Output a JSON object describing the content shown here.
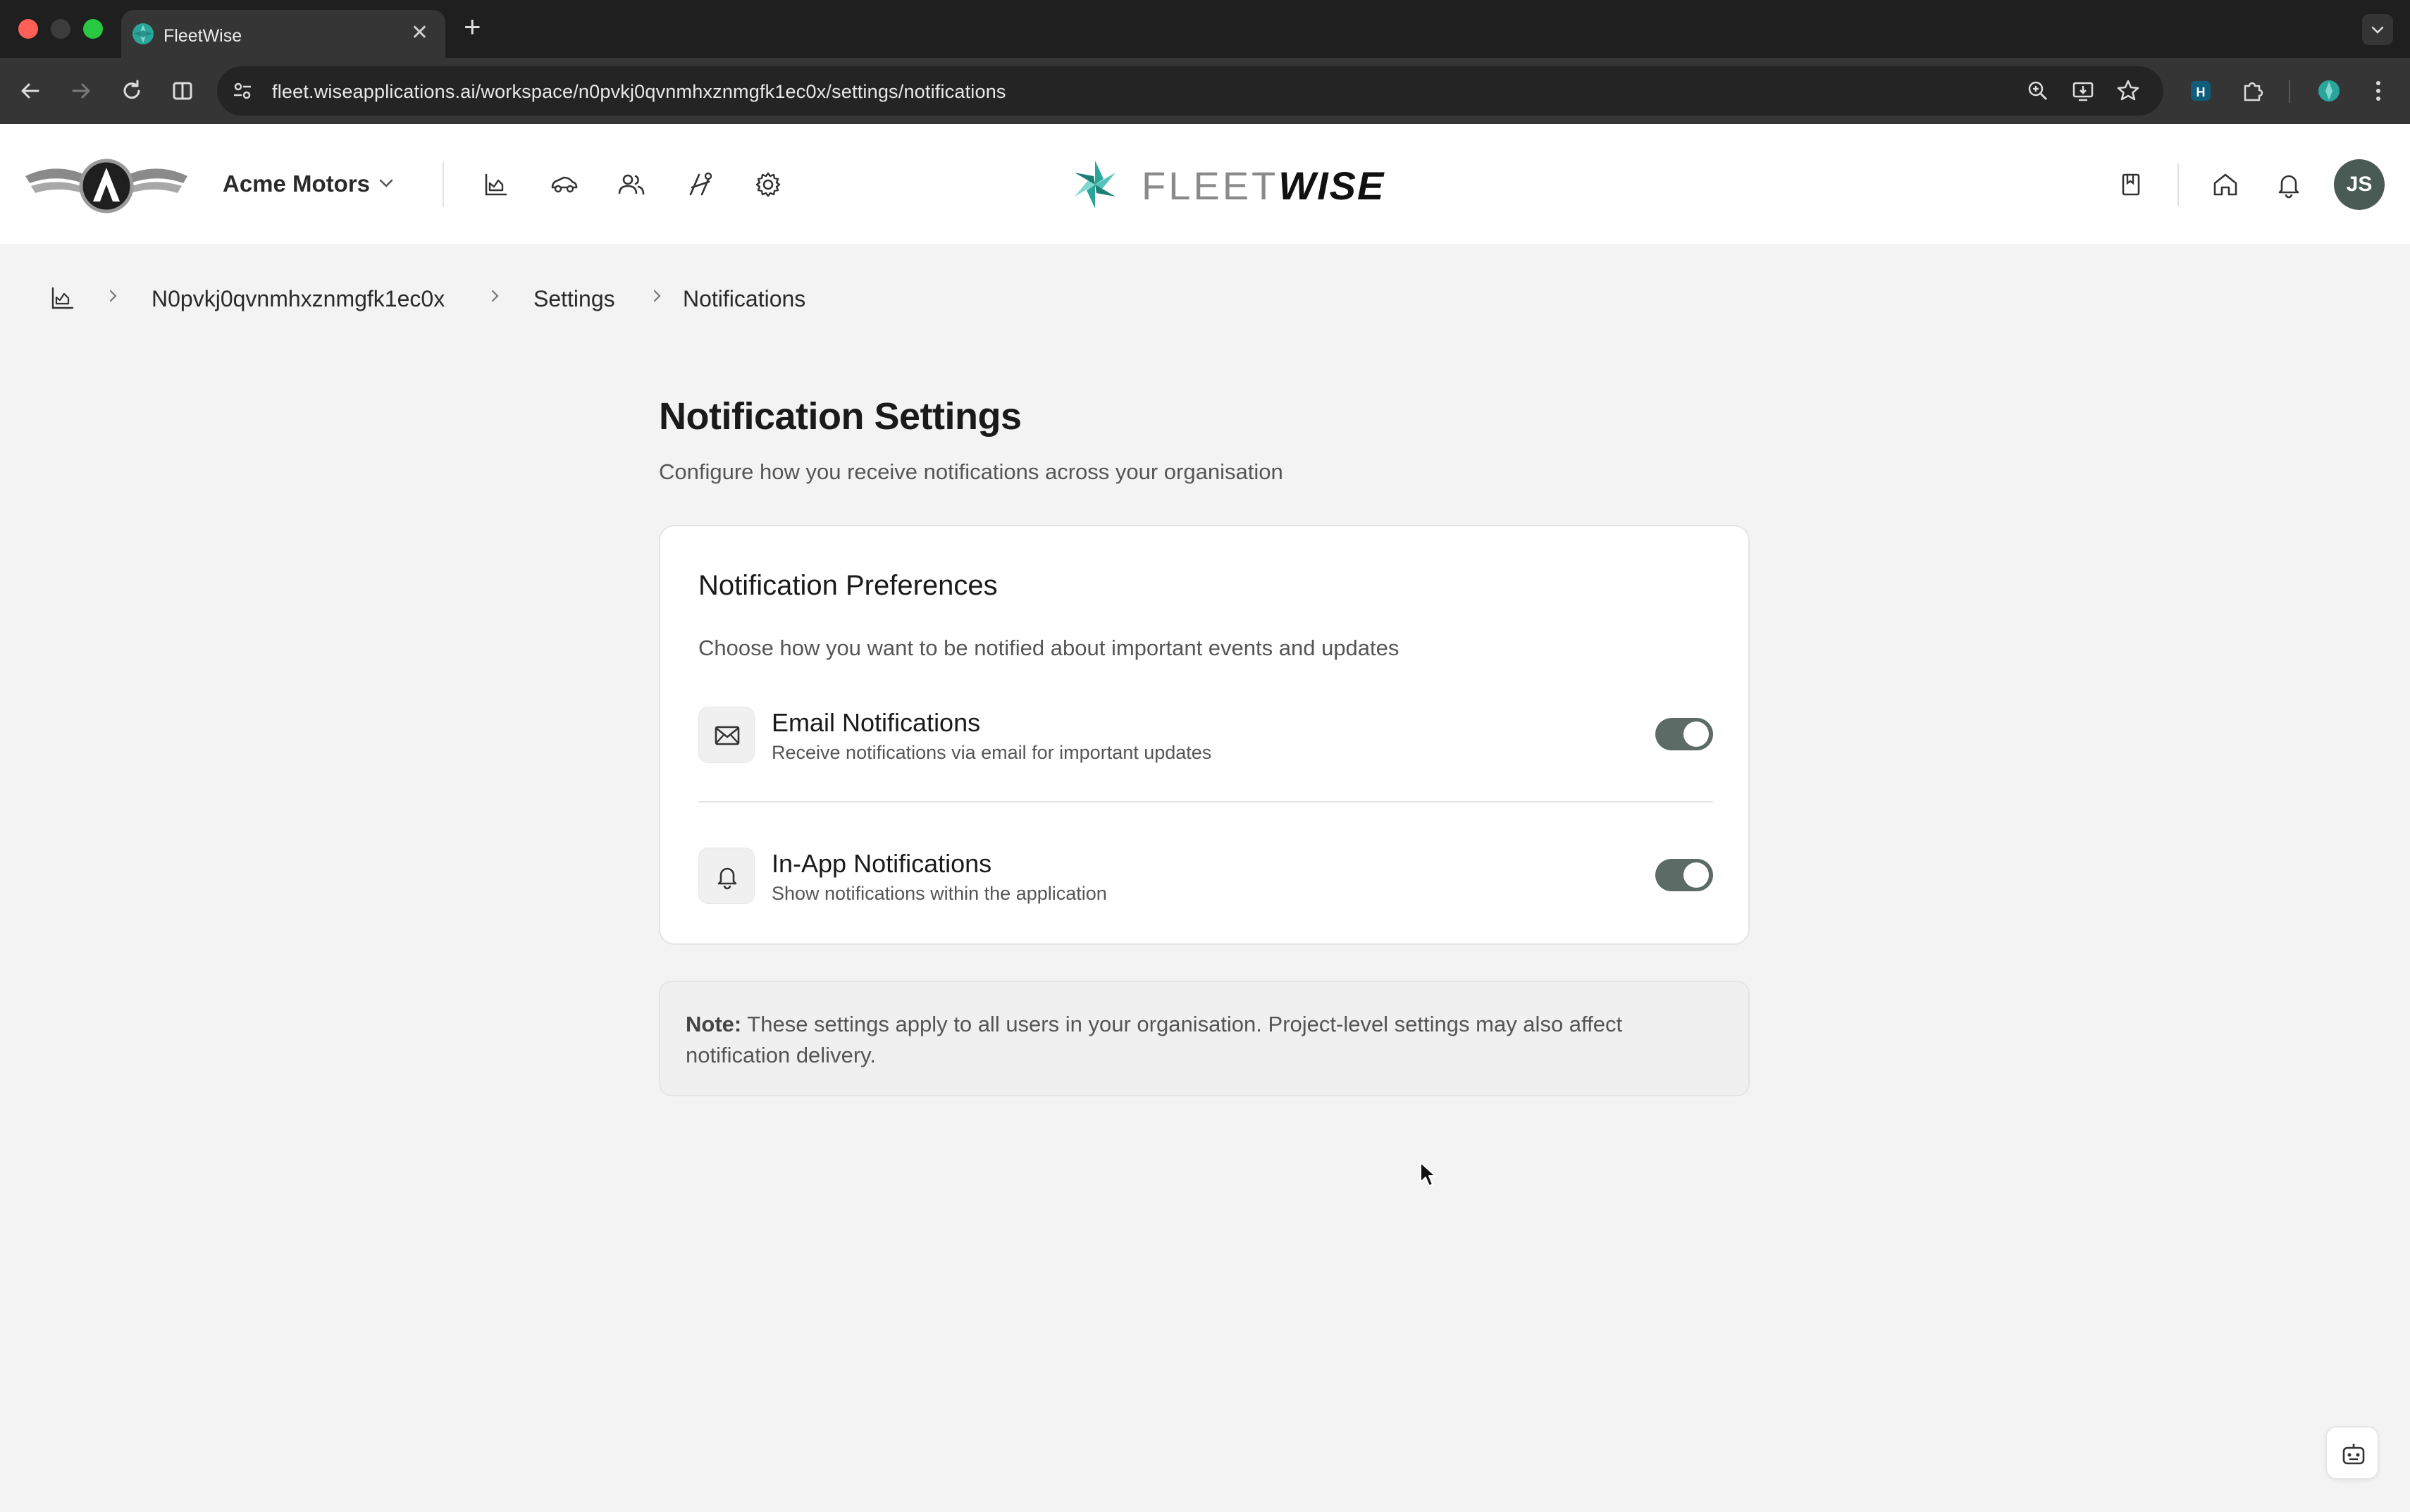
{
  "browser": {
    "tab_title": "FleetWise",
    "new_tab_symbol": "+",
    "url": "fleet.wiseapplications.ai/workspace/n0pvkj0qvnmhxznmgfk1ec0x/settings/notifications"
  },
  "header": {
    "org_name": "Acme Motors",
    "logo_fleet": "FLEET",
    "logo_wise": "WISE",
    "nav_icons": [
      "dashboard-icon",
      "vehicle-icon",
      "users-icon",
      "routes-icon",
      "settings-icon"
    ],
    "right_icons": [
      "bookmark-icon",
      "home-icon",
      "bell-icon"
    ],
    "avatar_initials": "JS"
  },
  "breadcrumb": {
    "items": [
      "N0pvkj0qvnmhxznmgfk1ec0x",
      "Settings",
      "Notifications"
    ]
  },
  "page": {
    "title": "Notification Settings",
    "subtitle": "Configure how you receive notifications across your organisation"
  },
  "preferences": {
    "title": "Notification Preferences",
    "description": "Choose how you want to be notified about important events and updates",
    "items": [
      {
        "title": "Email Notifications",
        "description": "Receive notifications via email for important updates",
        "enabled": true,
        "icon": "mail-icon"
      },
      {
        "title": "In-App Notifications",
        "description": "Show notifications within the application",
        "enabled": true,
        "icon": "bell-icon"
      }
    ]
  },
  "note": {
    "label": "Note:",
    "text": "These settings apply to all users in your organisation. Project-level settings may also affect notification delivery."
  },
  "colors": {
    "toggle_on": "#5c6b66",
    "avatar_bg": "#4a5a55",
    "page_bg": "#f3f3f3"
  }
}
